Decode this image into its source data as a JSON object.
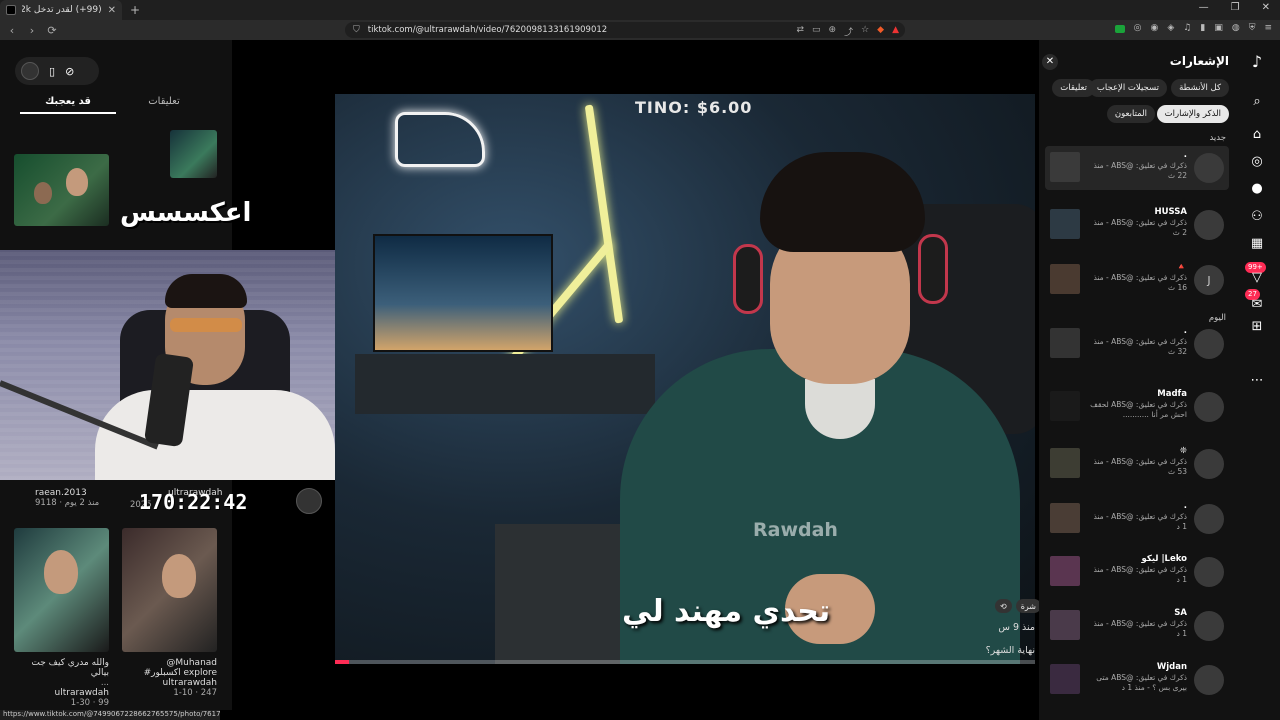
{
  "browser": {
    "tab_title": "(99+) لقدر تدخل 2k قبل نهاية الشهر",
    "new_tab": "+",
    "url": "tiktok.com/@ultrarawdah/video/7620098133161909012",
    "status_url": "https://www.tiktok.com/@7499067228662765575/photo/7617148717044436244"
  },
  "left_panel": {
    "tabs": [
      "قد يعجبك",
      "تعليقات"
    ],
    "overlay_text": "اعكسسس",
    "timer": "170:22:42",
    "cards": [
      {
        "user": "raean.2013",
        "meta": "9118 · منذ 2 يوم"
      },
      {
        "user": "ultrarawdah",
        "meta": "2025"
      },
      {
        "caption": "والله مدري كيف جت بيالي",
        "dots": "...",
        "user": "ultrarawdah",
        "meta": "1-30 · 99"
      },
      {
        "caption": "@Muhanad",
        "caption2": "#اكسبلور explore",
        "user": "ultrarawdah",
        "meta": "1-10 · 247"
      }
    ]
  },
  "video": {
    "price_text": "TINO: $6.00",
    "watermark": "Rawdah",
    "subtitle": "تحدي مهند لي",
    "time_ago": "منذ 9 س",
    "caption": "نهاية الشهر؟",
    "share_label": "شرة",
    "progress": 0.02,
    "accent": "#fe2c55"
  },
  "notifications": {
    "title": "الإشعارات",
    "chips": [
      "كل الأنشطة",
      "تسجيلات الإعجاب",
      "تعليقات",
      "الذكر والإشارات",
      "المتابعون"
    ],
    "section_new": "جديد",
    "section_today": "اليوم",
    "items": [
      {
        "name": ".",
        "text": "ذكرك في تعليق: @ABS - منذ 22 ث"
      },
      {
        "name": "HUSSA",
        "text": "ذكرك في تعليق: @ABS - منذ 2 ث"
      },
      {
        "name": "🔺",
        "text": "ذكرك في تعليق: @ABS - منذ 16 ث",
        "avatar": "J"
      },
      {
        "name": ".",
        "text": "ذكرك في تعليق: @ABS - منذ 32 ث"
      },
      {
        "name": "Madfa",
        "text": "ذكرك في تعليق: @ABS لحقف احش مر أنا ..........."
      },
      {
        "name": "❊",
        "text": "ذكرك في تعليق: @ABS - منذ 53 ث"
      },
      {
        "name": ".",
        "text": "ذكرك في تعليق: @ABS - منذ 1 د"
      },
      {
        "name": "Leko| ليكو",
        "text": "ذكرك في تعليق: @ABS - منذ 1 د"
      },
      {
        "name": "SA",
        "text": "ذكرك في تعليق: @ABS - منذ 1 د"
      },
      {
        "name": "Wjdan",
        "text": "ذكرك في تعليق: @ABS متى بيرى بس ؟ - منذ 1 د"
      }
    ]
  },
  "sidenav": {
    "badge_inbox": "99+",
    "badge_messages": "27"
  }
}
